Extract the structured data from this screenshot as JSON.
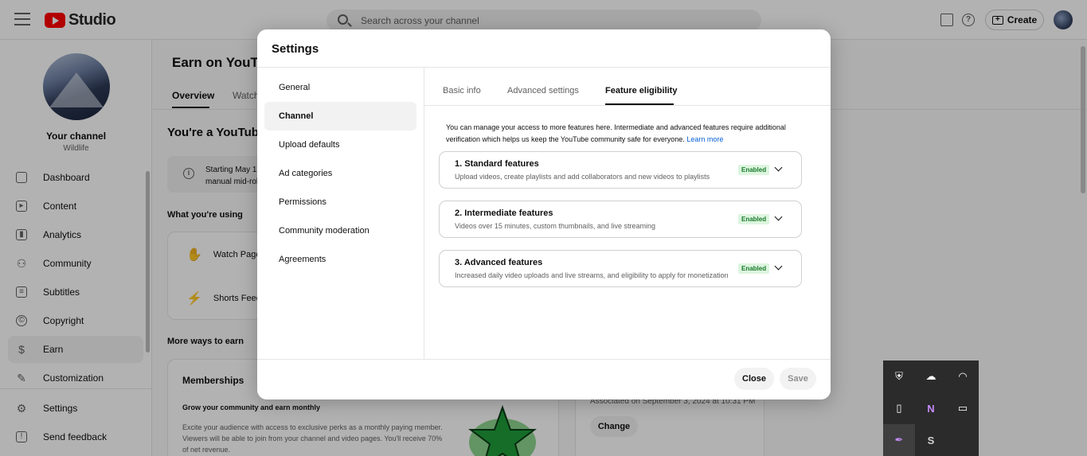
{
  "header": {
    "logo_text": "Studio",
    "search_placeholder": "Search across your channel",
    "help_icon": "?",
    "create_label": "Create",
    "create_icon": "+"
  },
  "sidebar": {
    "channel_name": "Your channel",
    "channel_sub": "Wildlife",
    "items": [
      {
        "label": "Dashboard",
        "icon": "dashboard-icon",
        "glyph": ""
      },
      {
        "label": "Content",
        "icon": "content-icon",
        "glyph": "▸"
      },
      {
        "label": "Analytics",
        "icon": "analytics-icon",
        "glyph": "▮"
      },
      {
        "label": "Community",
        "icon": "community-icon",
        "glyph": "⚇"
      },
      {
        "label": "Subtitles",
        "icon": "subtitles-icon",
        "glyph": "≡"
      },
      {
        "label": "Copyright",
        "icon": "copyright-icon",
        "glyph": "©"
      },
      {
        "label": "Earn",
        "icon": "earn-icon",
        "glyph": "$"
      },
      {
        "label": "Customization",
        "icon": "customization-icon",
        "glyph": "✎"
      },
      {
        "label": "Settings",
        "icon": "settings-icon",
        "glyph": "⚙"
      },
      {
        "label": "Send feedback",
        "icon": "feedback-icon",
        "glyph": "!"
      }
    ]
  },
  "main": {
    "title": "Earn on YouTu",
    "tabs": [
      "Overview",
      "Watch"
    ],
    "headline": "You're a YouTube",
    "info_icon": "i",
    "info_text_1": "Starting May 12",
    "info_text_2": "manual mid-rol",
    "using_label": "What you're using",
    "using_items": [
      {
        "label": "Watch Page",
        "icon": "watch-page-icon",
        "glyph": "✋"
      },
      {
        "label": "Shorts Feed",
        "icon": "shorts-feed-icon",
        "glyph": "⚡"
      }
    ],
    "more_label": "More ways to earn",
    "memberships": {
      "title": "Memberships",
      "subtitle": "Grow your community and earn monthly",
      "body": "Excite your audience with access to exclusive perks as a monthly paying member. Viewers will be able to join from your channel and video pages. You'll receive 70% of net revenue."
    },
    "association": {
      "text": "Associated on September 3, 2024 at 10:31 PM",
      "change_label": "Change"
    }
  },
  "modal": {
    "title": "Settings",
    "side_items": [
      "General",
      "Channel",
      "Upload defaults",
      "Ad categories",
      "Permissions",
      "Community moderation",
      "Agreements"
    ],
    "active_side_item": "Channel",
    "tabs": [
      "Basic info",
      "Advanced settings",
      "Feature eligibility"
    ],
    "active_tab": "Feature eligibility",
    "intro": "You can manage your access to more features here. Intermediate and advanced features require additional verification which helps us keep the YouTube community safe for everyone.",
    "learn_more": "Learn more",
    "features": [
      {
        "title": "1. Standard features",
        "desc": "Upload videos, create playlists and add collaborators and new videos to playlists",
        "status": "Enabled"
      },
      {
        "title": "2. Intermediate features",
        "desc": "Videos over 15 minutes, custom thumbnails, and live streaming",
        "status": "Enabled"
      },
      {
        "title": "3. Advanced features",
        "desc": "Increased daily video uploads and live streams, and eligibility to apply for monetization",
        "status": "Enabled"
      }
    ],
    "close_label": "Close",
    "save_label": "Save"
  },
  "tray": {
    "icons": [
      {
        "name": "security-shield-icon",
        "glyph": "⛨"
      },
      {
        "name": "cloud-off-icon",
        "glyph": "☁"
      },
      {
        "name": "wifi-icon",
        "glyph": "◠"
      },
      {
        "name": "usb-drive-icon",
        "glyph": "▯"
      },
      {
        "name": "onenote-icon",
        "glyph": "N"
      },
      {
        "name": "battery-icon",
        "glyph": "▭"
      },
      {
        "name": "feather-pen-icon",
        "glyph": "✒"
      },
      {
        "name": "skype-icon",
        "glyph": "S"
      }
    ]
  },
  "colors": {
    "accent_red": "#ff0000",
    "link_blue": "#065fd4",
    "enabled_green": "#177a2a",
    "enabled_bg": "#ddf5df"
  }
}
